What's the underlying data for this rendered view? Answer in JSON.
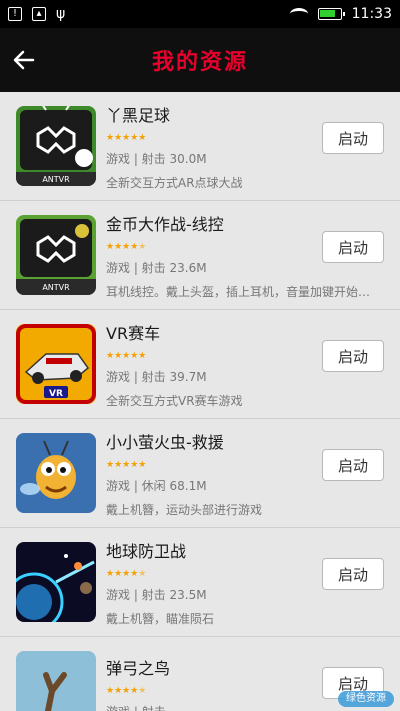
{
  "status_bar": {
    "time": "11:33"
  },
  "header": {
    "title": "我的资源"
  },
  "launch_label": "启动",
  "apps": [
    {
      "name": "丫黑足球",
      "category": "游戏",
      "sub": "射击",
      "size": "30.0M",
      "rating": 5,
      "desc": "全新交互方式AR点球大战",
      "icon": "antvr-football-icon"
    },
    {
      "name": "金币大作战-线控",
      "category": "游戏",
      "sub": "射击",
      "size": "23.6M",
      "rating": 4.5,
      "desc": "耳机线控。戴上头盔，插上耳机，音量加键开始游戏",
      "icon": "antvr-coin-icon"
    },
    {
      "name": "VR赛车",
      "category": "游戏",
      "sub": "射击",
      "size": "39.7M",
      "rating": 5,
      "desc": "全新交互方式VR赛车游戏",
      "icon": "vr-racing-icon"
    },
    {
      "name": "小小萤火虫-救援",
      "category": "游戏",
      "sub": "休闲",
      "size": "68.1M",
      "rating": 5,
      "desc": "戴上机簪，运动头部进行游戏",
      "icon": "firefly-icon"
    },
    {
      "name": "地球防卫战",
      "category": "游戏",
      "sub": "射击",
      "size": "23.5M",
      "rating": 4.5,
      "desc": "戴上机簪，瞄准陨石",
      "icon": "earth-defense-icon"
    },
    {
      "name": "弹弓之鸟",
      "category": "游戏",
      "sub": "射击",
      "size": "",
      "rating": 4.5,
      "desc": "",
      "icon": "slingshot-bird-icon"
    }
  ],
  "meta_sep": " | ",
  "watermark": "绿色资源"
}
